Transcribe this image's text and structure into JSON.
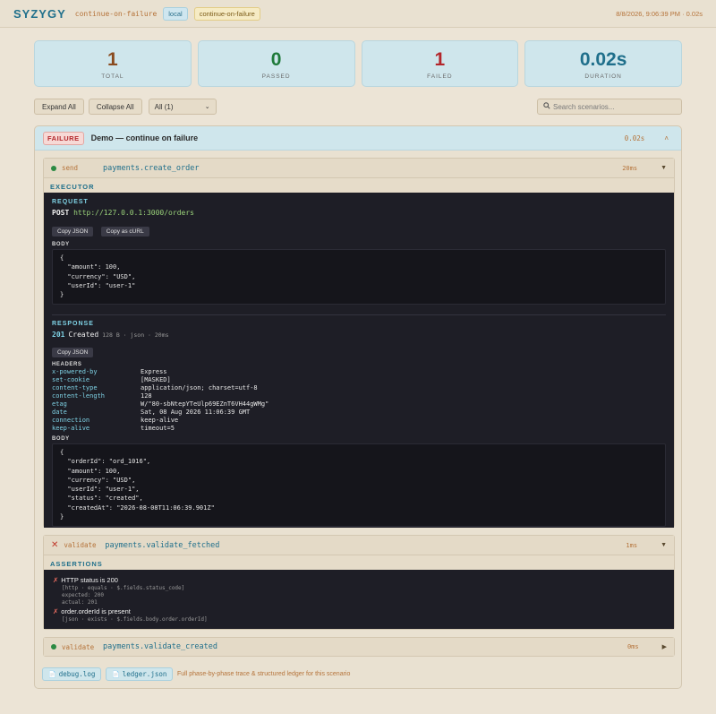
{
  "header": {
    "brand": "SYZYGY",
    "suite": "continue-on-failure",
    "tag_env": "local",
    "tag_suite": "continue-on-failure",
    "run_meta": "8/8/2026, 9:06:39 PM  ·  0.02s"
  },
  "stats": [
    {
      "value": "1",
      "label": "TOTAL",
      "color": "#8a4b1f"
    },
    {
      "value": "0",
      "label": "PASSED",
      "color": "#1f7a3a"
    },
    {
      "value": "1",
      "label": "FAILED",
      "color": "#b3262b"
    },
    {
      "value": "0.02s",
      "label": "DURATION",
      "color": "#1f6f8b"
    }
  ],
  "toolbar": {
    "expand_label": "Expand All",
    "collapse_label": "Collapse All",
    "filter_selected": "All (1)",
    "search_placeholder": "Search scenarios..."
  },
  "scenario": {
    "status": "FAILURE",
    "title": "Demo — continue on failure",
    "duration": "0.02s",
    "caret": "˄"
  },
  "steps": [
    {
      "phase": "send",
      "name": "payments.create_order",
      "duration": "20ms",
      "status": "pass",
      "caret": "▼",
      "section": "EXECUTOR",
      "request": {
        "label": "REQUEST",
        "method": "POST",
        "url": "http://127.0.0.1:3000/orders",
        "copy_json": "Copy JSON",
        "copy_curl": "Copy as cURL",
        "body_label": "BODY",
        "body": "{\n  \"amount\": 100,\n  \"currency\": \"USD\",\n  \"userId\": \"user-1\"\n}"
      },
      "response": {
        "label": "RESPONSE",
        "status_code": "201",
        "status_text": "Created",
        "meta": "128 B · json · 20ms",
        "copy_json": "Copy JSON",
        "headers_label": "HEADERS",
        "headers": [
          {
            "k": "x-powered-by",
            "v": "Express"
          },
          {
            "k": "set-cookie",
            "v": "[MASKED]"
          },
          {
            "k": "content-type",
            "v": "application/json; charset=utf-8"
          },
          {
            "k": "content-length",
            "v": "128"
          },
          {
            "k": "etag",
            "v": "W/\"80-sbNtepYTeUlp69EZnT6VH44gWMg\""
          },
          {
            "k": "date",
            "v": "Sat, 08 Aug 2026 11:06:39 GMT"
          },
          {
            "k": "connection",
            "v": "keep-alive"
          },
          {
            "k": "keep-alive",
            "v": "timeout=5"
          }
        ],
        "body_label": "BODY",
        "body": "{\n  \"orderId\": \"ord_1016\",\n  \"amount\": 100,\n  \"currency\": \"USD\",\n  \"userId\": \"user-1\",\n  \"status\": \"created\",\n  \"createdAt\": \"2026-08-08T11:06:39.901Z\"\n}"
      }
    },
    {
      "phase": "validate",
      "name": "payments.validate_fetched",
      "duration": "1ms",
      "status": "fail",
      "caret": "▼",
      "section": "ASSERTIONS",
      "assertions": [
        {
          "mark": "✗",
          "title": "HTTP status is 200",
          "detail": "[http · equals · $.fields.status_code]\nexpected: 200\nactual: 201"
        },
        {
          "mark": "✗",
          "title": "order.orderId is present",
          "detail": "[json · exists · $.fields.body.order.orderId]"
        }
      ]
    },
    {
      "phase": "validate",
      "name": "payments.validate_created",
      "duration": "0ms",
      "status": "pass",
      "caret": "▶"
    }
  ],
  "footer": {
    "debug_log": "debug.log",
    "ledger": "ledger.json",
    "note": "Full phase-by-phase trace & structured ledger for this scenario"
  }
}
